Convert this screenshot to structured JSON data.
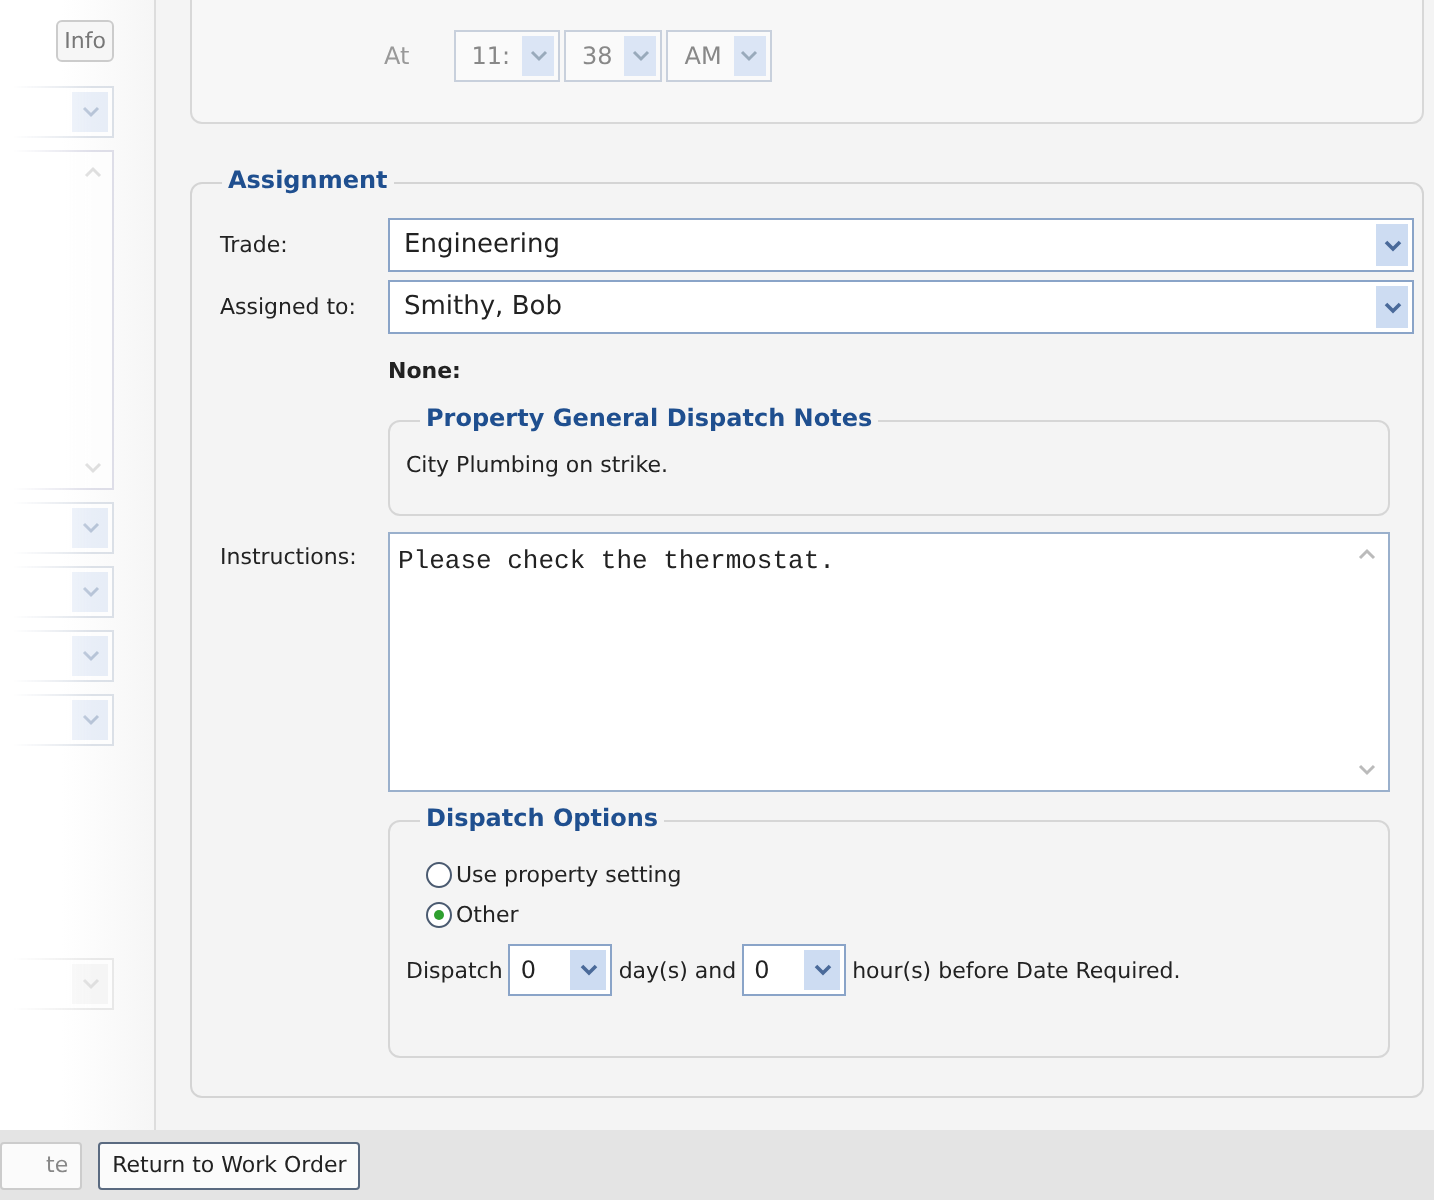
{
  "left_panel": {
    "button": "Info"
  },
  "schedule": {
    "at_label": "At",
    "time": [
      {
        "value": "11:"
      },
      {
        "value": "38"
      },
      {
        "value": "AM"
      }
    ]
  },
  "assignment": {
    "title": "Assignment",
    "trade": {
      "label": "Trade:",
      "value": "Engineering"
    },
    "assigned_to": {
      "label": "Assigned to:",
      "value": "Smithy, Bob"
    },
    "none_label": "None:",
    "notes": {
      "title": "Property General Dispatch Notes",
      "text": "City Plumbing on strike."
    },
    "instructions": {
      "label": "Instructions:",
      "value": "Please check the thermostat."
    },
    "dispatch_options": {
      "title": "Dispatch Options",
      "options": [
        {
          "label": "Use property setting",
          "selected": false
        },
        {
          "label": "Other",
          "selected": true
        }
      ],
      "dispatch_label": "Dispatch",
      "days": "0",
      "days_label": "day(s) and",
      "hours": "0",
      "hours_label": "hour(s) before Date Required."
    }
  },
  "footer_buttons": [
    {
      "label": "te",
      "disabled": true
    },
    {
      "label": "Return to Work Order",
      "disabled": false
    }
  ]
}
